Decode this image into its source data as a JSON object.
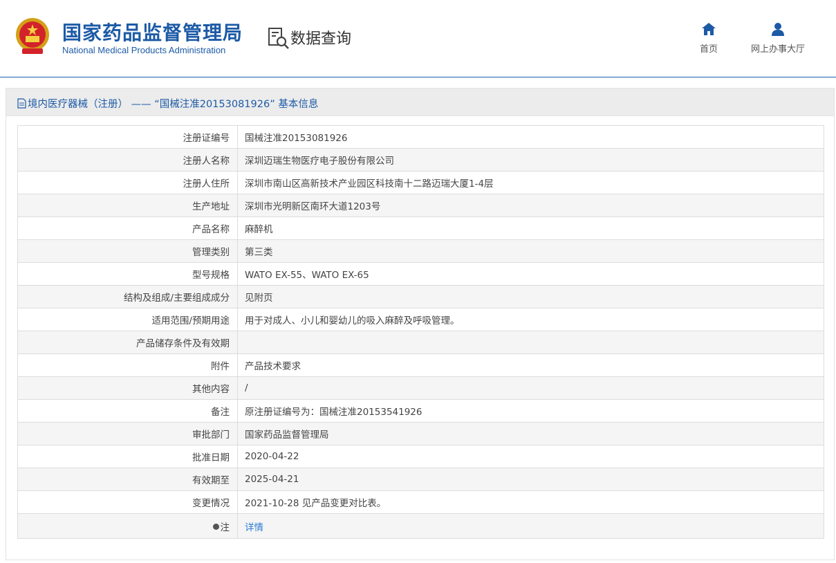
{
  "header": {
    "org_name_cn": "国家药品监督管理局",
    "org_name_en": "National Medical Products Administration",
    "section_title": "数据查询",
    "nav": [
      {
        "label": "首页",
        "icon": "home-icon"
      },
      {
        "label": "网上办事大厅",
        "icon": "user-icon"
      }
    ],
    "brand_color": "#1c5aa6"
  },
  "panel": {
    "title": "境内医疗器械（注册） ——  “国械注准20153081926” 基本信息"
  },
  "rows": [
    {
      "label": "注册证编号",
      "value": "国械注准20153081926"
    },
    {
      "label": "注册人名称",
      "value": "深圳迈瑞生物医疗电子股份有限公司"
    },
    {
      "label": "注册人住所",
      "value": "深圳市南山区高新技术产业园区科技南十二路迈瑞大厦1-4层"
    },
    {
      "label": "生产地址",
      "value": "深圳市光明新区南环大道1203号"
    },
    {
      "label": "产品名称",
      "value": "麻醉机"
    },
    {
      "label": "管理类别",
      "value": "第三类"
    },
    {
      "label": "型号规格",
      "value": "WATO EX-55、WATO EX-65"
    },
    {
      "label": "结构及组成/主要组成成分",
      "value": "见附页"
    },
    {
      "label": "适用范围/预期用途",
      "value": "用于对成人、小儿和婴幼儿的吸入麻醉及呼吸管理。"
    },
    {
      "label": "产品储存条件及有效期",
      "value": ""
    },
    {
      "label": "附件",
      "value": "产品技术要求"
    },
    {
      "label": "其他内容",
      "value": "/"
    },
    {
      "label": "备注",
      "value": "原注册证编号为：国械注准20153541926"
    },
    {
      "label": "审批部门",
      "value": "国家药品监督管理局"
    },
    {
      "label": "批准日期",
      "value": "2020-04-22"
    },
    {
      "label": "有效期至",
      "value": "2025-04-21"
    },
    {
      "label": "变更情况",
      "value": "2021-10-28 见产品变更对比表。"
    }
  ],
  "note_row": {
    "label": "注",
    "link_text": "详情"
  }
}
